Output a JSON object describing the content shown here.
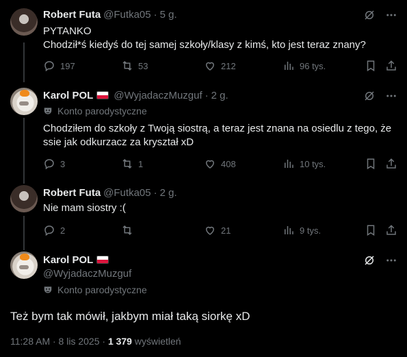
{
  "colors": {
    "background": "#000000",
    "text": "#e7e9ea",
    "muted": "#71767b",
    "line": "#333639"
  },
  "tweets": [
    {
      "name": "Robert Futa",
      "handle": "@Futka05",
      "time": "5 g.",
      "text_line1": "PYTANKO",
      "text_line2": "Chodził*ś kiedyś do tej samej szkoły/klasy z kimś, kto jest teraz znany?",
      "replies": "197",
      "reposts": "53",
      "likes": "212",
      "views": "96 tys."
    },
    {
      "name": "Karol POL",
      "handle": "@WyjadaczMuzguf",
      "time": "2 g.",
      "parody": "Konto parodystyczne",
      "text_line1": "Chodziłem do szkoły z Twoją siostrą, a teraz jest znana na osiedlu z tego, że",
      "text_line2": "ssie jak odkurzacz za kryształ xD",
      "replies": "3",
      "reposts": "1",
      "likes": "408",
      "views": "10 tys."
    },
    {
      "name": "Robert Futa",
      "handle": "@Futka05",
      "time": "2 g.",
      "text": "Nie mam siostry :(",
      "replies": "2",
      "likes": "21",
      "views": "9 tys."
    }
  ],
  "main": {
    "name": "Karol POL",
    "handle": "@WyjadaczMuzguf",
    "parody": "Konto parodystyczne",
    "text": "Też bym tak mówił, jakbym miał taką siorkę xD",
    "timestamp": "11:28 AM · 8 lis 2025 · ",
    "views_count": "1 379",
    "views_label": " wyświetleń"
  },
  "icons": [
    "grok-icon",
    "more-icon",
    "reply-icon",
    "repost-icon",
    "like-icon",
    "views-icon",
    "bookmark-icon",
    "share-icon",
    "parody-mask-icon",
    "poland-flag-icon"
  ]
}
